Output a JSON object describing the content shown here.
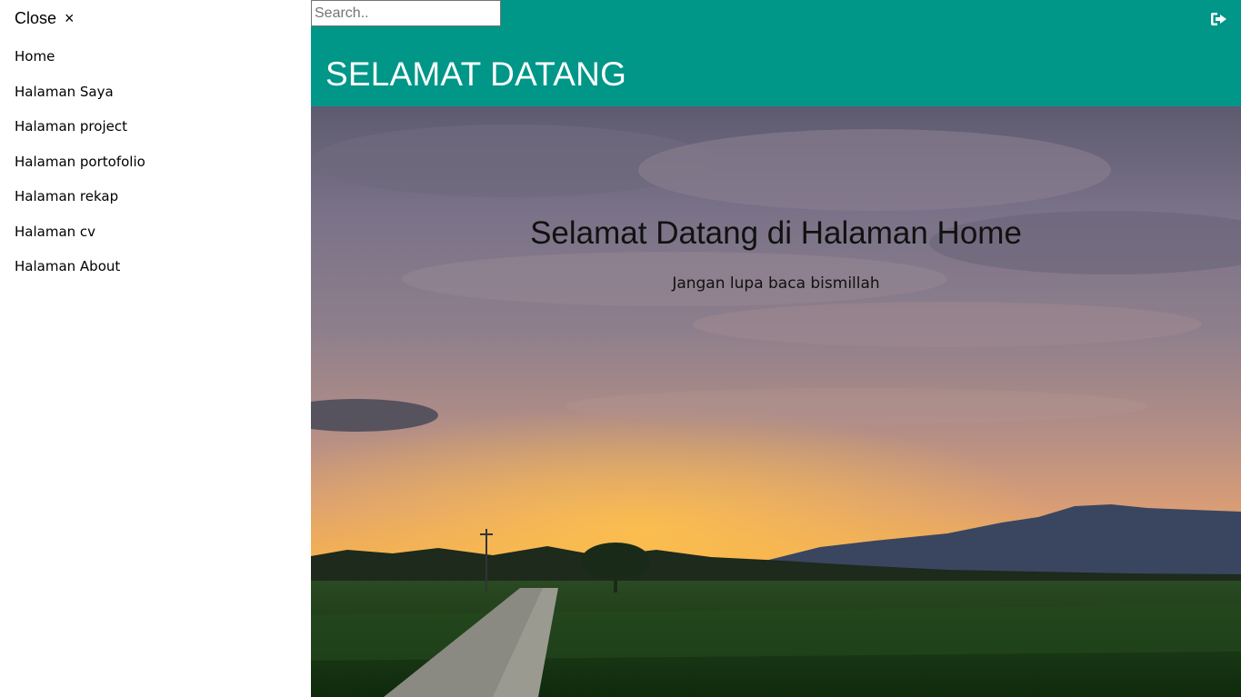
{
  "sidebar": {
    "close_label": "Close",
    "close_icon": "×",
    "items": [
      {
        "label": "Home"
      },
      {
        "label": "Halaman Saya"
      },
      {
        "label": "Halaman project"
      },
      {
        "label": "Halaman portofolio"
      },
      {
        "label": "Halaman rekap"
      },
      {
        "label": "Halaman cv"
      },
      {
        "label": "Halaman About"
      }
    ]
  },
  "header": {
    "search_placeholder": "Search..",
    "title": "SELAMAT DATANG",
    "logout_icon": "sign-out-icon",
    "color": "#009688"
  },
  "hero": {
    "heading": "Selamat Datang di Halaman Home",
    "subtext": "Jangan lupa baca bismillah",
    "image": "sunset-rice-field-image"
  }
}
